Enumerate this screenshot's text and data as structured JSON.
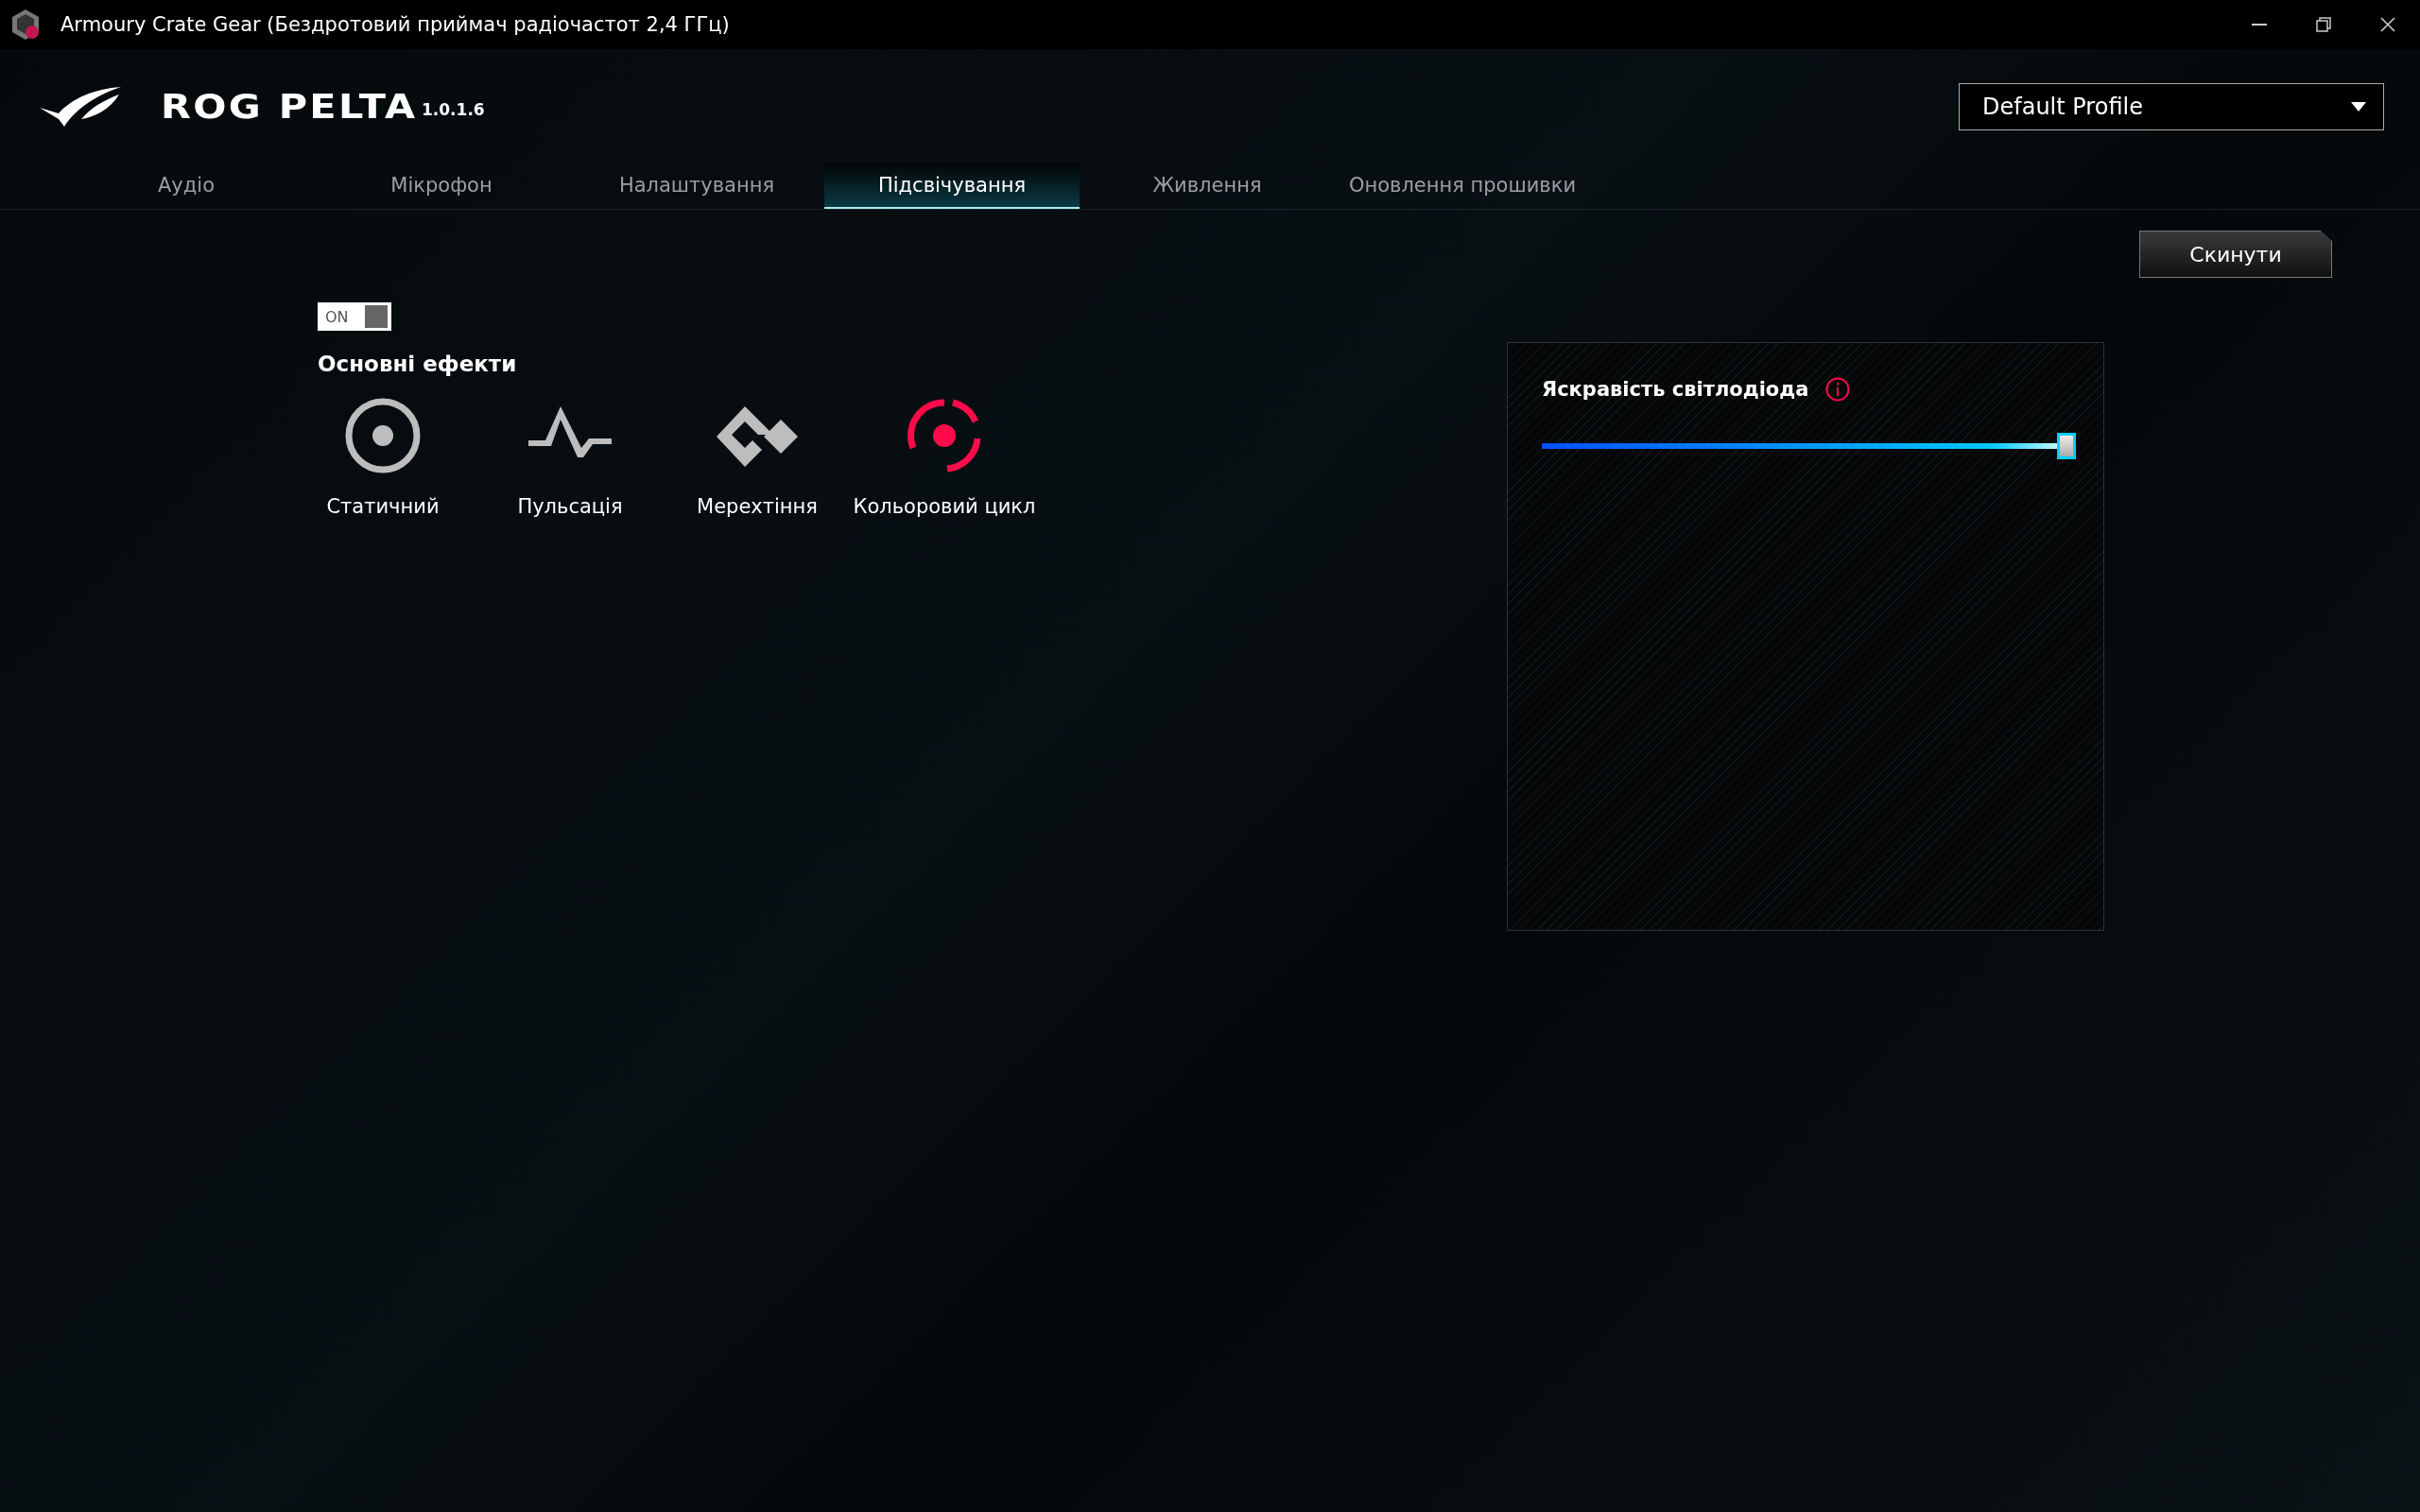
{
  "window": {
    "title": "Armoury Crate Gear (Бездротовий приймач радіочастот 2,4 ГГц)"
  },
  "header": {
    "product": "ROG PELTA",
    "version": "1.0.1.6",
    "profile": "Default Profile"
  },
  "tabs": [
    {
      "label": "Аудіо",
      "selected": false
    },
    {
      "label": "Мікрофон",
      "selected": false
    },
    {
      "label": "Налаштування",
      "selected": false
    },
    {
      "label": "Підсвічування",
      "selected": true
    },
    {
      "label": "Живлення",
      "selected": false
    },
    {
      "label": "Оновлення прошивки",
      "selected": false
    }
  ],
  "reset_button": "Скинути",
  "lighting": {
    "toggle": {
      "label": "ON",
      "on": true
    },
    "section_title": "Основні ефекти",
    "effects": [
      {
        "kind": "static",
        "label": "Статичний",
        "selected": false
      },
      {
        "kind": "pulse",
        "label": "Пульсація",
        "selected": false
      },
      {
        "kind": "flash",
        "label": "Мерехтіння",
        "selected": false
      },
      {
        "kind": "cycle",
        "label": "Кольоровий цикл",
        "selected": true
      }
    ]
  },
  "brightness": {
    "title": "Яскравість світлодіода",
    "level": 1
  }
}
